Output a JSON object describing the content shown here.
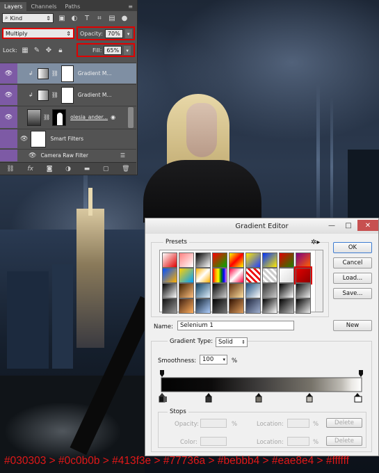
{
  "layers_panel": {
    "tabs": [
      "Layers",
      "Channels",
      "Paths"
    ],
    "filter_kind": "Kind",
    "blend_mode": "Multiply",
    "opacity_label": "Opacity:",
    "opacity_value": "70%",
    "lock_label": "Lock:",
    "fill_label": "Fill:",
    "fill_value": "65%",
    "layers": [
      {
        "name": "Gradient M...",
        "selected": true
      },
      {
        "name": "Gradient M...",
        "selected": false
      },
      {
        "name": "olesia_ander...",
        "selected": false
      }
    ],
    "smart_filters_label": "Smart Filters",
    "camera_raw_label": "Camera Raw Filter"
  },
  "gradient_editor": {
    "title": "Gradient Editor",
    "presets_label": "Presets",
    "buttons": {
      "ok": "OK",
      "cancel": "Cancel",
      "load": "Load...",
      "save": "Save...",
      "new": "New"
    },
    "name_label": "Name:",
    "name_value": "Selenium 1",
    "gradient_type_label": "Gradient Type:",
    "gradient_type_value": "Solid",
    "smoothness_label": "Smoothness:",
    "smoothness_value": "100",
    "percent": "%",
    "stops_label": "Stops",
    "opacity_label": "Opacity:",
    "location_label": "Location:",
    "color_label": "Color:",
    "delete_label": "Delete",
    "gradient_colors": [
      "#030303",
      "#0c0b0b",
      "#413f3e",
      "#77736a",
      "#bebbb4",
      "#eae8e4",
      "#ffffff"
    ]
  },
  "caption": "#030303 > #0c0b0b > #413f3e > #77736a > #bebbb4 > #eae8e4 > #ffffff"
}
